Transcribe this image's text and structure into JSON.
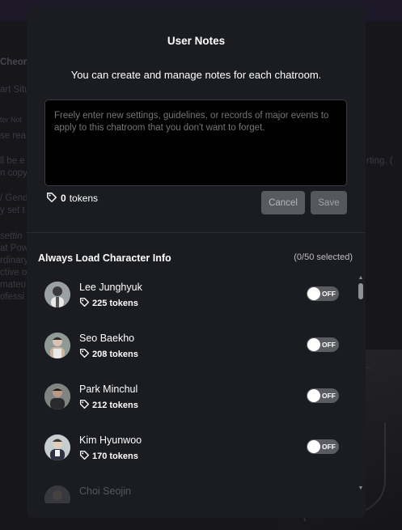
{
  "background": {
    "lines": [
      "Cheora",
      "art Situ",
      "tor Not",
      "se rea",
      "ll be e",
      "n copy",
      "/ Gend",
      "y set t",
      "settin",
      "at Pow",
      "rdinary",
      "ctive o",
      "mateu",
      "ofessi",
      "rting. ("
    ]
  },
  "modal": {
    "title": "User Notes",
    "description": "You can create and manage notes for each chatroom.",
    "note_placeholder": "Freely enter new settings, guidelines, or records of major events to apply to this chatroom that you don't want to forget.",
    "note_value": "",
    "token_count": "0",
    "token_unit": "tokens",
    "cancel_label": "Cancel",
    "save_label": "Save",
    "section_title": "Always Load Character Info",
    "section_count": "(0/50 selected)",
    "characters": [
      {
        "name": "Lee Junghyuk",
        "tokens": "225",
        "unit": "tokens",
        "toggle": "OFF"
      },
      {
        "name": "Seo Baekho",
        "tokens": "208",
        "unit": "tokens",
        "toggle": "OFF"
      },
      {
        "name": "Park Minchul",
        "tokens": "212",
        "unit": "tokens",
        "toggle": "OFF"
      },
      {
        "name": "Kim Hyunwoo",
        "tokens": "170",
        "unit": "tokens",
        "toggle": "OFF"
      },
      {
        "name": "Choi Seojin",
        "tokens": "",
        "unit": "",
        "toggle": ""
      }
    ]
  },
  "icons": {
    "token": "tag-icon",
    "scroll_up": "triangle-up-icon",
    "scroll_down": "triangle-down-icon"
  },
  "colors": {
    "modal_bg": "#1b1c22",
    "toggle_off": "#5b5c61",
    "button_bg": "#585a60"
  }
}
